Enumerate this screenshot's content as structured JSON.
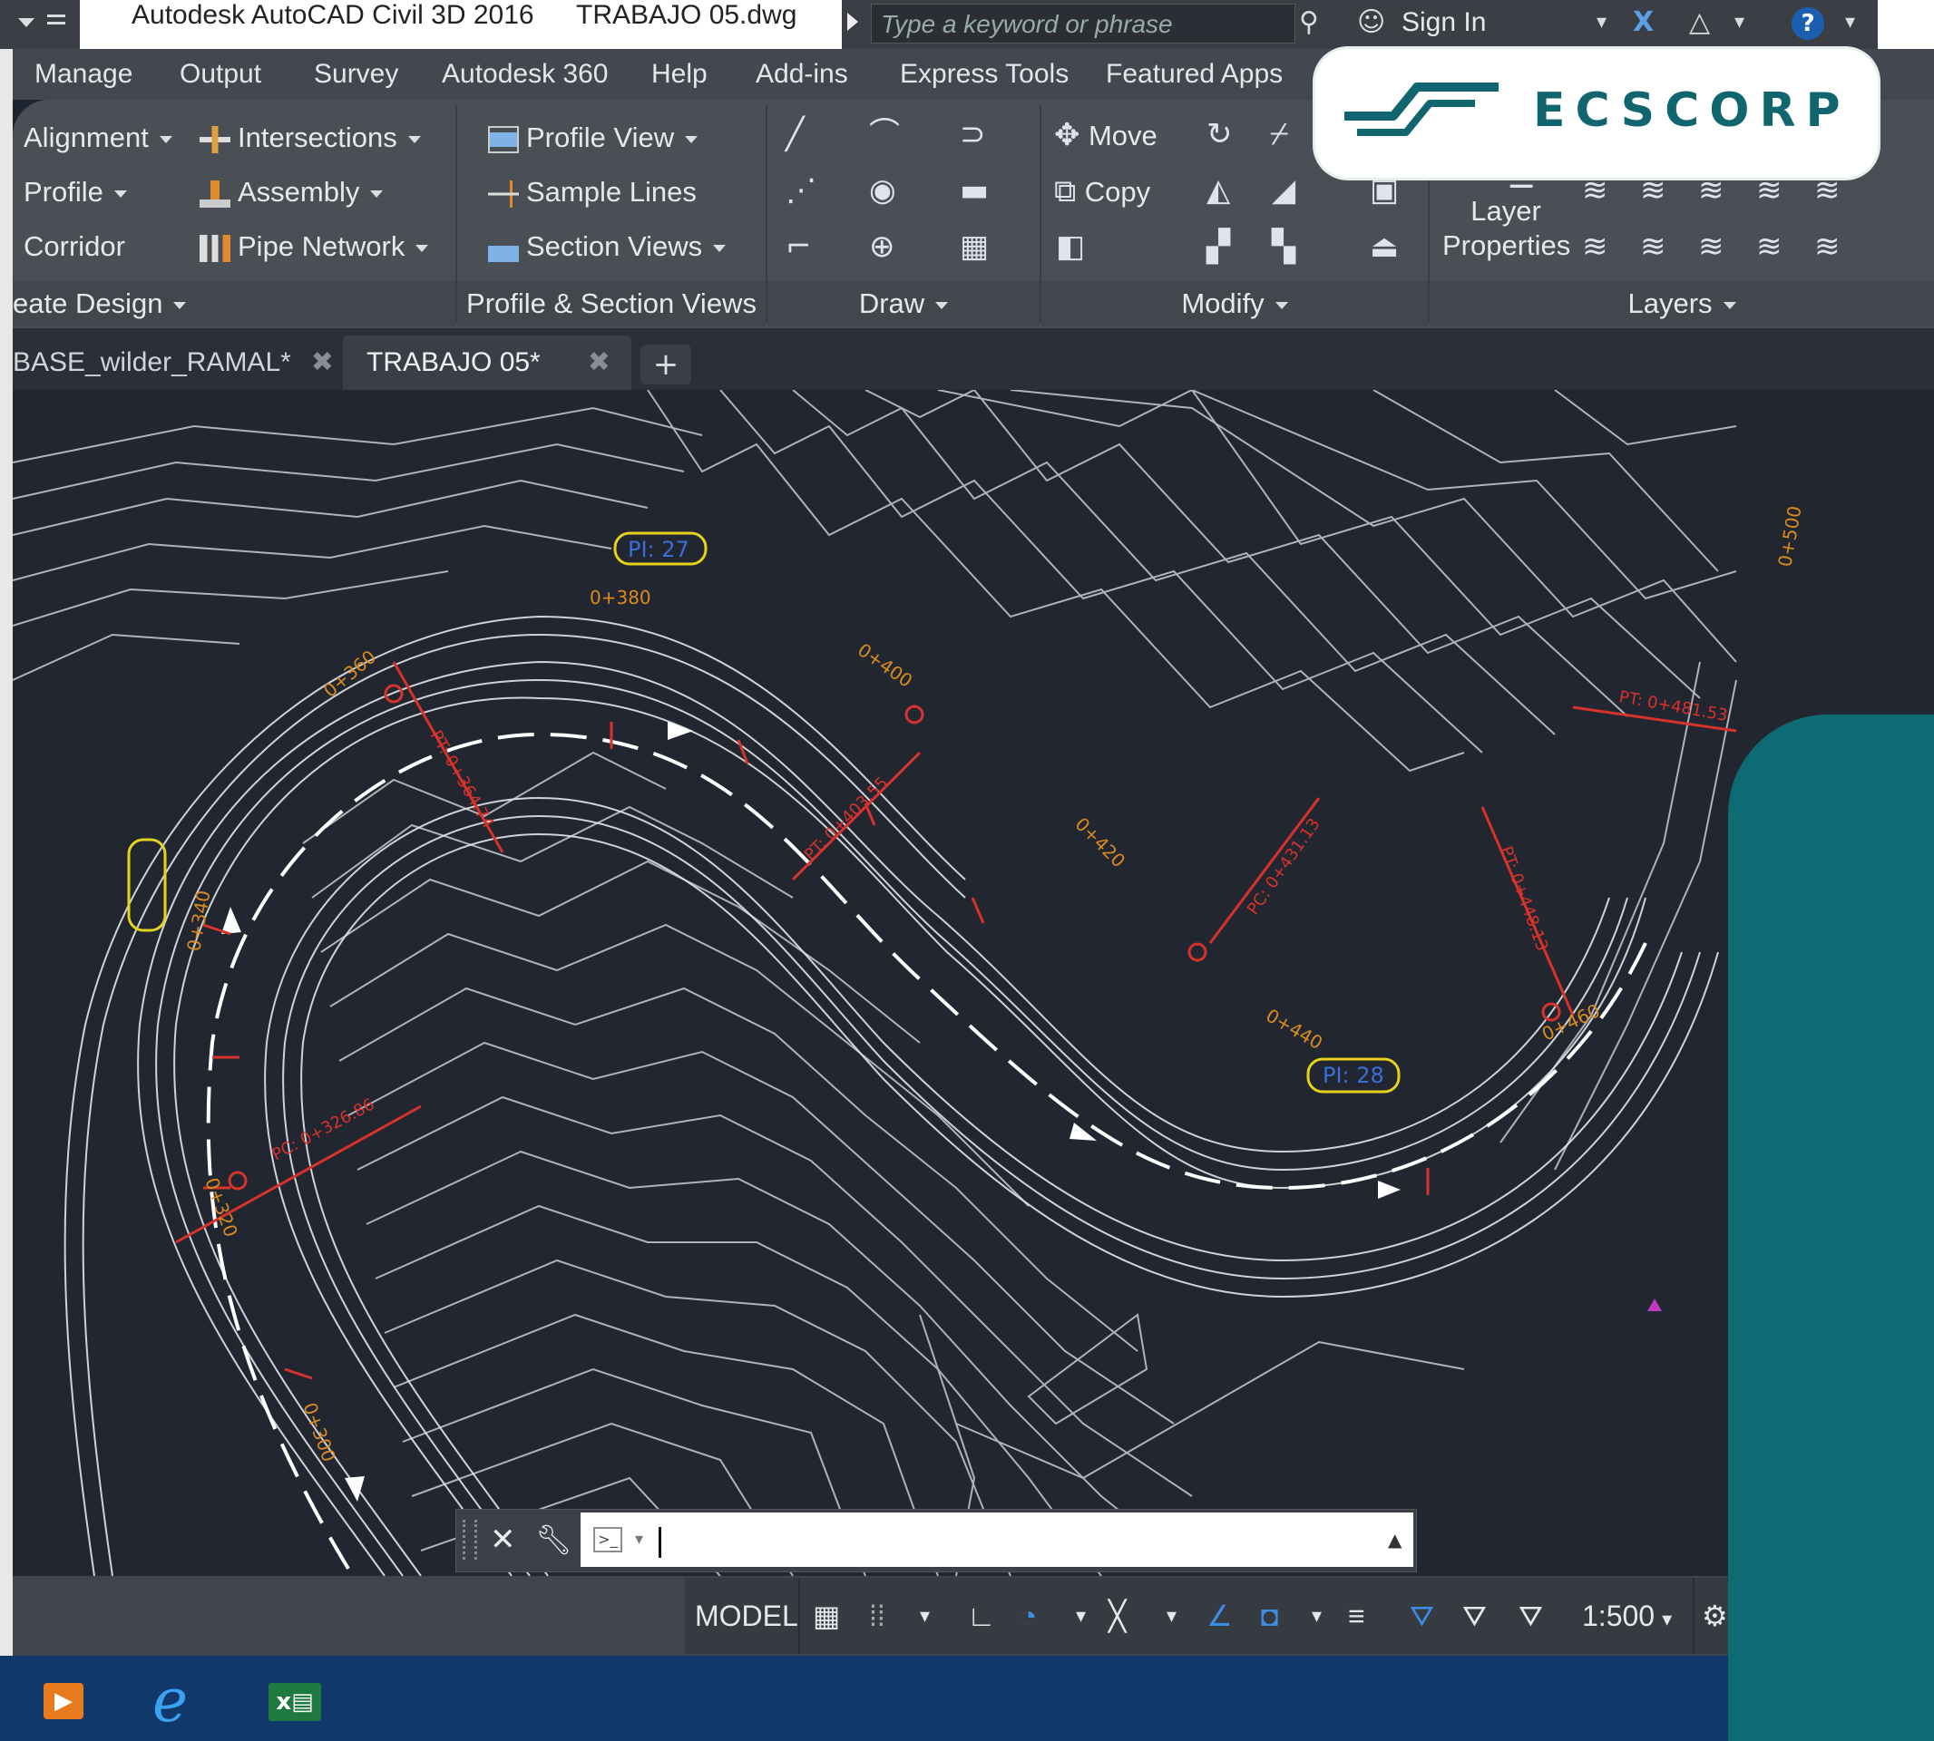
{
  "titlebar": {
    "app_title": "Autodesk AutoCAD Civil 3D 2016",
    "file_title": "TRABAJO 05.dwg",
    "search_placeholder": "Type a keyword or phrase",
    "sign_in": "Sign In"
  },
  "menu": [
    "Manage",
    "Output",
    "Survey",
    "Autodesk 360",
    "Help",
    "Add-ins",
    "Express Tools",
    "Featured Apps"
  ],
  "ribbon": {
    "create_design": {
      "items": [
        "Alignment",
        "Profile",
        "Corridor",
        "Intersections",
        "Assembly",
        "Pipe Network"
      ],
      "title": "eate Design"
    },
    "profile_section": {
      "items": [
        "Profile View",
        "Sample Lines",
        "Section Views"
      ],
      "title": "Profile & Section Views"
    },
    "draw": {
      "title": "Draw"
    },
    "modify": {
      "items": [
        "Move",
        "Copy"
      ],
      "title": "Modify"
    },
    "layers": {
      "layer_properties_line1": "Layer",
      "layer_properties_line2": "Properties",
      "title": "Layers"
    }
  },
  "tabs": [
    {
      "label": "BASE_wilder_RAMAL*"
    },
    {
      "label": "TRABAJO 05*"
    }
  ],
  "drawing_labels": {
    "pi27": "PI: 27",
    "pi28": "PI: 28",
    "st_380": "0+380",
    "st_360": "0+360",
    "st_400": "0+400",
    "st_340": "0+340",
    "st_320": "0+320",
    "st_300": "0+300",
    "st_420": "0+420",
    "st_440": "0+440",
    "st_460": "0+460",
    "st_500": "0+500",
    "pt_1": "PT: 0+364.74",
    "pt_2": "PT: 0+403.55",
    "pc_1": "PC: 0+326.86",
    "pc_2": "PC: 0+431.13",
    "pt_3": "PT: 0+448.13",
    "pt_4": "PT: 0+481.53"
  },
  "statusbar": {
    "model": "MODEL",
    "scale": "1:500"
  },
  "logo": {
    "text": "ECSCORP"
  },
  "colors": {
    "drawing_bg": "#212630",
    "contour": "#c8ccd2",
    "station_text": "#d98a1e",
    "red_marks": "#d8322c",
    "pi_label": "#e6d21a",
    "teal": "#0c6b73",
    "taskbar": "#11386b"
  }
}
